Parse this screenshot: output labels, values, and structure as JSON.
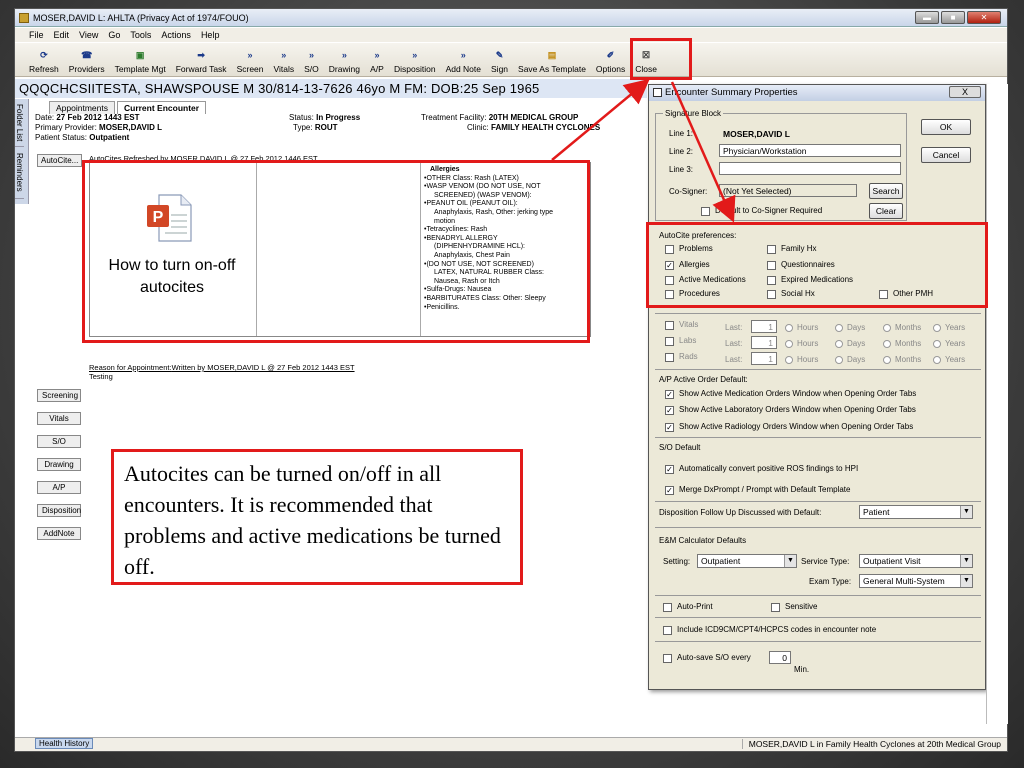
{
  "window": {
    "title": "MOSER,DAVID L: AHLTA  (Privacy Act of 1974/FOUO)"
  },
  "menu": [
    "File",
    "Edit",
    "View",
    "Go",
    "Tools",
    "Actions",
    "Help"
  ],
  "toolbar": {
    "refresh": "Refresh",
    "providers": "Providers",
    "template_mgt": "Template Mgt",
    "forward_task": "Forward Task",
    "screen": "Screen",
    "vitals": "Vitals",
    "so": "S/O",
    "drawing": "Drawing",
    "ap": "A/P",
    "disposition": "Disposition",
    "add_note": "Add Note",
    "sign": "Sign",
    "save_as_template": "Save As Template",
    "options": "Options",
    "close": "Close"
  },
  "patient_bar": "QQQCHCSIITESTA, SHAWSPOUSE M  30/814-13-7626  46yo  M   FM:  DOB:25 Sep 1965",
  "left_strip": [
    "Folder List",
    "Reminders"
  ],
  "tabs": [
    "Appointments",
    "Current Encounter"
  ],
  "encounter": {
    "date_label": "Date:",
    "date": "27 Feb 2012 1443 EST",
    "status_label": "Status:",
    "status": "In Progress",
    "facility_label": "Treatment Facility:",
    "facility": "20TH MEDICAL GROUP",
    "provider_label": "Primary Provider:",
    "provider": "MOSER,DAVID L",
    "type_label": "Type:",
    "type": "ROUT",
    "clinic_label": "Clinic:",
    "clinic": "FAMILY HEALTH CYCLONES",
    "pstatus_label": "Patient Status:",
    "pstatus": "Outpatient"
  },
  "autocite": {
    "button": "AutoCite...",
    "refreshed_prefix": "AutoCites",
    "refreshed": "Refreshed by MOSER,DAVID L @ 27 Feb 2012 1446 EST",
    "howto": "How to turn on-off autocites",
    "allergies_title": "Allergies",
    "allergies": [
      "•OTHER Class: Rash (LATEX)",
      "•WASP VENOM (DO NOT USE, NOT",
      "   SCREENED) (WASP VENOM):",
      "•PEANUT OIL (PEANUT OIL):",
      "   Anaphylaxis, Rash, Other: jerking type",
      "   motion",
      "•Tetracyclines: Rash",
      "•BENADRYL ALLERGY",
      "   (DIPHENHYDRAMINE HCL):",
      "   Anaphylaxis, Chest Pain",
      "•(DO NOT USE, NOT SCREENED)",
      "   LATEX, NATURAL RUBBER Class:",
      "   Nausea, Rash or Itch",
      "•Sulfa-Drugs: Nausea",
      "•BARBITURATES Class: Other: Sleepy",
      "•Penicillins."
    ]
  },
  "reason": {
    "label": "Reason for Appointment:",
    "text": "Written by MOSER,DAVID L @ 27 Feb 2012 1443 EST",
    "value": "Testing"
  },
  "side_buttons": [
    "Screening",
    "Vitals",
    "S/O",
    "Drawing",
    "A/P",
    "Disposition",
    "AddNote"
  ],
  "callout": "Autocites can be turned on/off in all encounters. It is recommended that problems and active medications be turned off.",
  "status_bar": {
    "health_history": "Health History",
    "user": "MOSER,DAVID L in Family Health Cyclones at 20th Medical Group"
  },
  "dialog": {
    "title": "Encounter Summary  Properties",
    "close": "X",
    "signature_block": "Signature Block",
    "line1_label": "Line 1:",
    "line1": "MOSER,DAVID L",
    "line2_label": "Line 2:",
    "line2": "Physician/Workstation",
    "line3_label": "Line 3:",
    "line3": "",
    "cosigner_label": "Co-Signer:",
    "cosigner": "(Not Yet Selected)",
    "default_cosigner": "Default to Co-Signer Required",
    "ok": "OK",
    "cancel": "Cancel",
    "search": "Search",
    "clear": "Clear",
    "autocite_prefs": "AutoCite preferences:",
    "prefs": {
      "problems": "Problems",
      "family_hx": "Family Hx",
      "allergies": "Allergies",
      "questionnaires": "Questionnaires",
      "active_meds": "Active Medications",
      "expired_meds": "Expired Medications",
      "procedures": "Procedures",
      "social_hx": "Social Hx",
      "other_pmh": "Other PMH"
    },
    "vitals": "Vitals",
    "labs": "Labs",
    "rads": "Rads",
    "last": "Last:",
    "last_val": "1",
    "hours": "Hours",
    "days": "Days",
    "months": "Months",
    "years": "Years",
    "ap_default": "A/P Active Order Default:",
    "ap1": "Show Active Medication Orders Window when Opening Order Tabs",
    "ap2": "Show Active Laboratory Orders Window when Opening Order Tabs",
    "ap3": "Show Active Radiology Orders Window when Opening Order Tabs",
    "so_default": "S/O Default",
    "so1": "Automatically convert positive ROS findings to HPI",
    "so2": "Merge DxPrompt / Prompt with Default Template",
    "disp_label": "Disposition Follow Up Discussed with Default:",
    "disp_value": "Patient",
    "em_defaults": "E&M Calculator Defaults",
    "setting_label": "Setting:",
    "setting": "Outpatient",
    "service_label": "Service Type:",
    "service": "Outpatient Visit",
    "exam_label": "Exam Type:",
    "exam": "General Multi-System",
    "auto_print": "Auto-Print",
    "sensitive": "Sensitive",
    "include_codes": "Include ICD9CM/CPT4/HCPCS codes in encounter note",
    "autosave": "Auto-save S/O every",
    "autosave_val": "0",
    "min": "Min."
  },
  "colors": {
    "highlight": "#e21a1a",
    "patient_bar": "#dde6f4"
  }
}
